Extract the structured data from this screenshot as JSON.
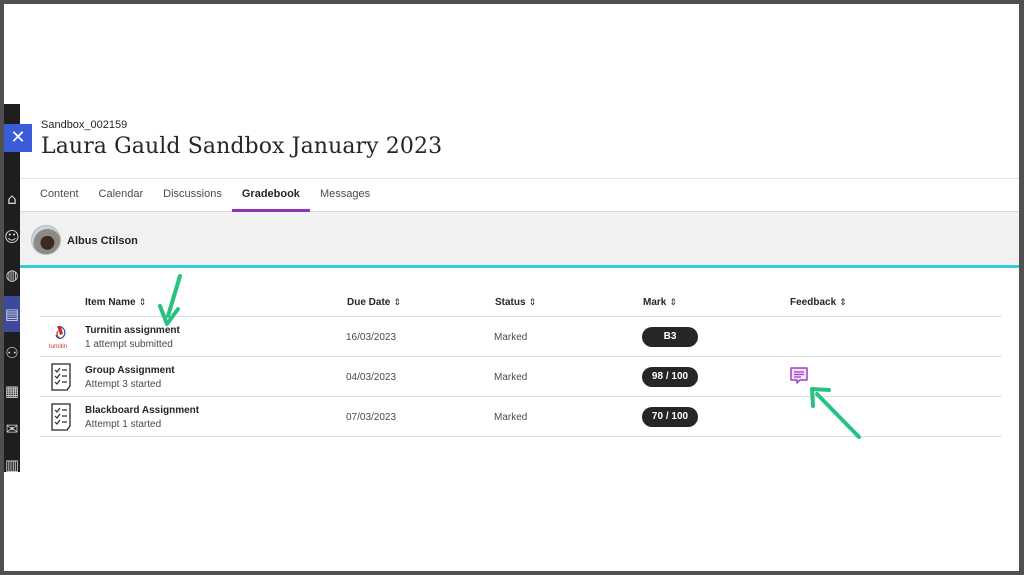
{
  "course": {
    "id": "Sandbox_002159",
    "title": "Laura Gauld Sandbox January 2023"
  },
  "nav": {
    "close_icon": "✕",
    "icons": [
      "institution-icon",
      "profile-icon",
      "globe-icon",
      "courses-icon",
      "groups-icon",
      "calendar-icon",
      "messages-icon",
      "grades-icon"
    ]
  },
  "tabs": [
    {
      "label": "Content"
    },
    {
      "label": "Calendar"
    },
    {
      "label": "Discussions"
    },
    {
      "label": "Gradebook"
    },
    {
      "label": "Messages"
    }
  ],
  "active_tab": "Gradebook",
  "student": {
    "name": "Albus Ctilson"
  },
  "table": {
    "sort_glyph": "⇕",
    "headers": {
      "item_name": "Item Name",
      "due_date": "Due Date",
      "status": "Status",
      "mark": "Mark",
      "feedback": "Feedback"
    },
    "rows": [
      {
        "icon": "turnitin-icon",
        "name": "Turnitin assignment",
        "sub": "1 attempt submitted",
        "due": "16/03/2023",
        "status": "Marked",
        "mark": "B3",
        "feedback": false,
        "turnitin_logo_text": "turnitin"
      },
      {
        "icon": "assignment-icon",
        "name": "Group Assignment",
        "sub": "Attempt 3 started",
        "due": "04/03/2023",
        "status": "Marked",
        "mark": "98 / 100",
        "feedback": true
      },
      {
        "icon": "assignment-icon",
        "name": "Blackboard Assignment",
        "sub": "Attempt 1 started",
        "due": "07/03/2023",
        "status": "Marked",
        "mark": "70 / 100",
        "feedback": false
      }
    ]
  },
  "colors": {
    "accent_tab": "#8e35b5",
    "student_bar_underline": "#38c9dc",
    "close_button": "#3c5bd6",
    "feedback_icon": "#a13fc9",
    "annotation_arrow": "#27c281"
  }
}
